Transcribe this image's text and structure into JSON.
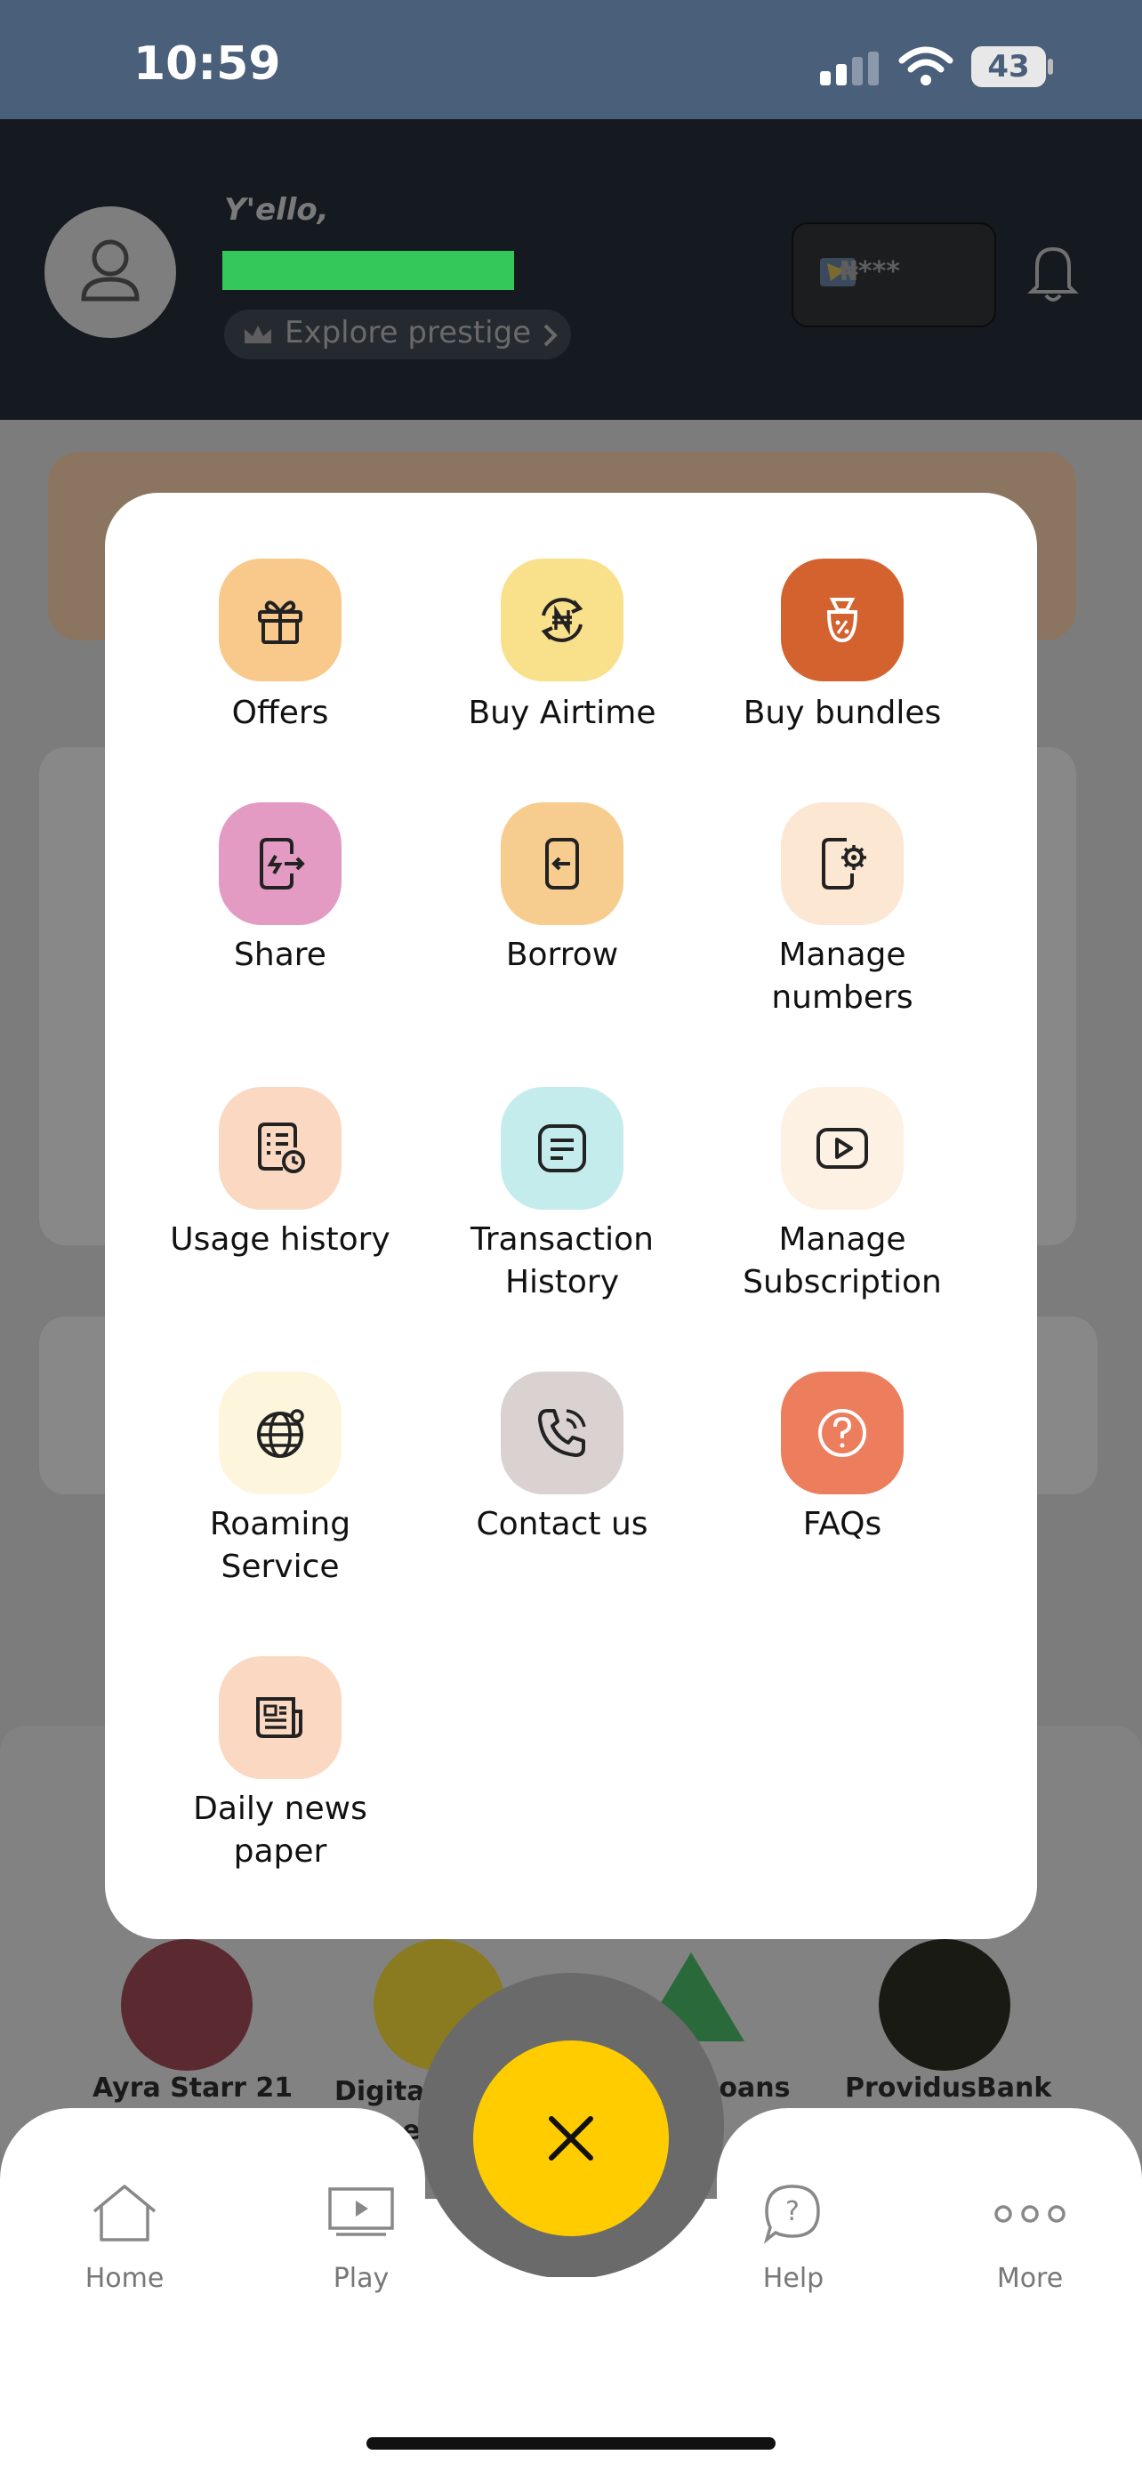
{
  "status_bar": {
    "time": "10:59",
    "battery": "43"
  },
  "header": {
    "greeting": "Y'ello,",
    "prestige_label": "Explore prestige",
    "wallet_balance": "₦***"
  },
  "menu": {
    "items": [
      {
        "label": "Offers",
        "icon": "gift-icon",
        "color": "#f8c98b"
      },
      {
        "label": "Buy Airtime",
        "icon": "naira-refresh-icon",
        "color": "#f9e08a"
      },
      {
        "label": "Buy bundles",
        "icon": "bundle-bag-icon",
        "color": "#d4622f"
      },
      {
        "label": "Share",
        "icon": "share-phone-icon",
        "color": "#e39bc3"
      },
      {
        "label": "Borrow",
        "icon": "borrow-icon",
        "color": "#f7cc8f"
      },
      {
        "label": "Manage\nnumbers",
        "icon": "phone-settings-icon",
        "color": "#fbe7d2"
      },
      {
        "label": "Usage history",
        "icon": "usage-history-icon",
        "color": "#fbd8c2"
      },
      {
        "label": "Transaction\nHistory",
        "icon": "transaction-icon",
        "color": "#c5ecec"
      },
      {
        "label": "Manage\nSubscription",
        "icon": "play-box-icon",
        "color": "#fdf1e4"
      },
      {
        "label": "Roaming\nService",
        "icon": "globe-icon",
        "color": "#fdf6dd"
      },
      {
        "label": "Contact us",
        "icon": "phone-call-icon",
        "color": "#dad1d1"
      },
      {
        "label": "FAQs",
        "icon": "question-icon",
        "color": "#ec7d5d"
      },
      {
        "label": "Daily news\npaper",
        "icon": "newspaper-icon",
        "color": "#fbd8c2"
      }
    ]
  },
  "background_apps": [
    {
      "label": "Ayra Starr 21"
    },
    {
      "label": "Digital Fan Game"
    },
    {
      "label": "nd Loans"
    },
    {
      "label": "ProvidusBank"
    }
  ],
  "bottom_nav": {
    "home": "Home",
    "play": "Play",
    "help": "Help",
    "more": "More"
  },
  "colors": {
    "accent": "#ffcc00",
    "status_bar": "#4a5f7a",
    "header": "#141a20"
  }
}
